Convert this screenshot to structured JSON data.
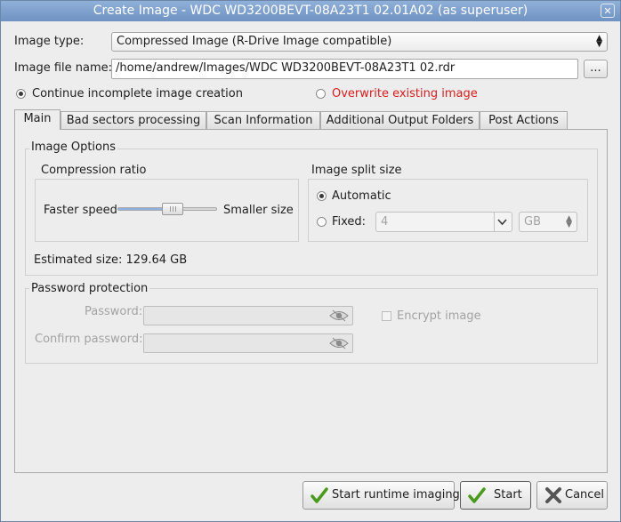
{
  "window": {
    "title": "Create Image - WDC WD3200BEVT-08A23T1 02.01A02 (as superuser)",
    "close_glyph": "✕"
  },
  "image_type": {
    "label": "Image type:",
    "value": "Compressed Image (R-Drive Image compatible)"
  },
  "image_file": {
    "label": "Image file name:",
    "value": "/home/andrew/Images/WDC WD3200BEVT-08A23T1 02.rdr",
    "browse_label": "..."
  },
  "mode": {
    "continue_label": "Continue incomplete image creation",
    "overwrite_label": "Overwrite existing image",
    "selected": "continue",
    "overwrite_color": "#d42020"
  },
  "tabs": [
    {
      "label": "Main",
      "active": true
    },
    {
      "label": "Bad sectors processing",
      "active": false
    },
    {
      "label": "Scan Information",
      "active": false
    },
    {
      "label": "Additional Output Folders",
      "active": false
    },
    {
      "label": "Post Actions",
      "active": false
    }
  ],
  "image_options": {
    "title": "Image Options",
    "compression": {
      "title": "Compression ratio",
      "left_label": "Faster speed",
      "right_label": "Smaller size",
      "level": 0.55
    },
    "split": {
      "title": "Image split size",
      "automatic_label": "Automatic",
      "fixed_label": "Fixed:",
      "selected": "automatic",
      "fixed_value": "4",
      "unit": "GB"
    },
    "estimated_label": "Estimated size: 129.64 GB"
  },
  "password": {
    "title": "Password protection",
    "password_label": "Password:",
    "confirm_label": "Confirm password:",
    "encrypt_label": "Encrypt image"
  },
  "actions": {
    "runtime_label": "Start runtime imaging",
    "start_label": "Start",
    "cancel_label": "Cancel",
    "check_color": "#4a9a1c",
    "cancel_color": "#555555"
  }
}
